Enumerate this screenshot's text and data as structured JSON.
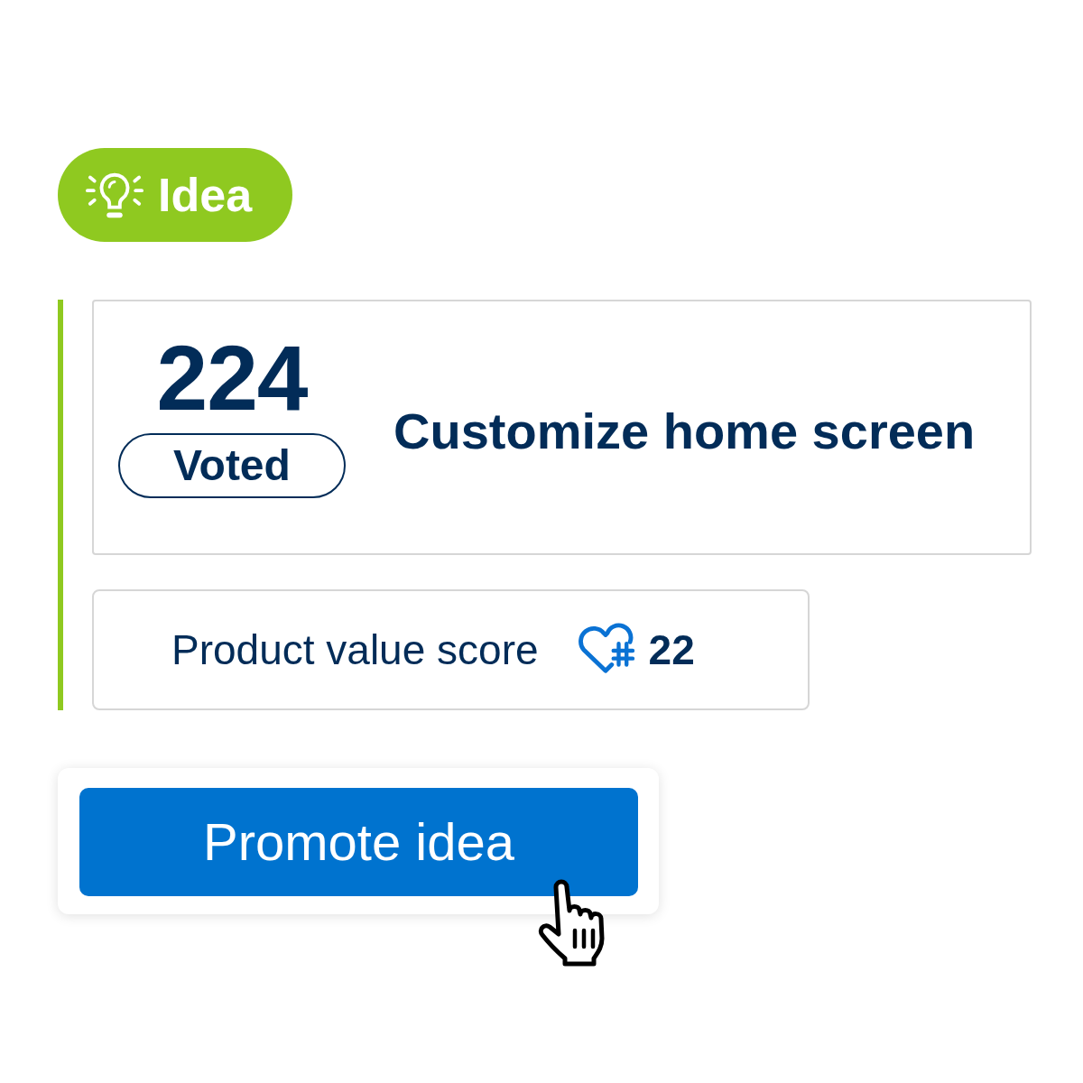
{
  "tag": {
    "label": "Idea"
  },
  "idea_card": {
    "votes": "224",
    "vote_status": {
      "label": "Voted",
      "voted": true
    },
    "title": "Customize home screen"
  },
  "score": {
    "label": "Product value score",
    "value": "22"
  },
  "actions": {
    "primary_button": "Promote idea"
  }
}
